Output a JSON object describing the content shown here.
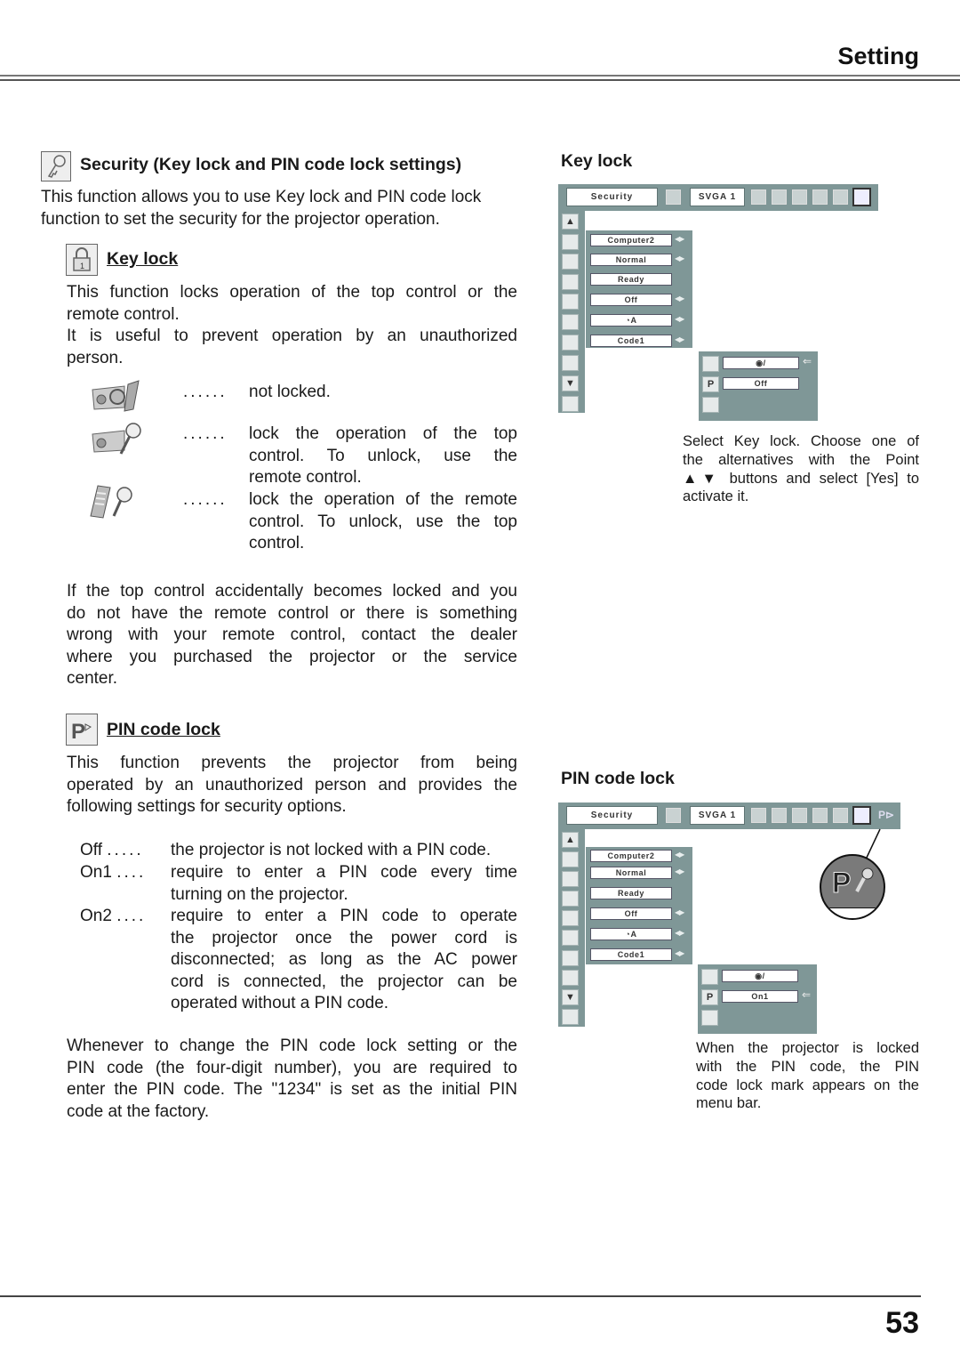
{
  "header": {
    "section_title": "Setting"
  },
  "footer": {
    "page_number": "53"
  },
  "security": {
    "icon": "key-icon",
    "title": "Security (Key lock and PIN code lock settings)",
    "intro_line1": "This function allows you to use Key lock and PIN code lock",
    "intro_line2": "function to set the security for the projector operation."
  },
  "key_lock": {
    "icon": "padlock-icon",
    "heading": "Key lock",
    "para1_line1": "This function locks operation of the top control or the",
    "para1_line2": "remote control.",
    "para2_line1": "It is useful to prevent operation by an unauthorized",
    "para2_line2": "person.",
    "options": [
      {
        "icon": "projector-unlocked-icon",
        "dots": "......",
        "lines": [
          "not locked."
        ]
      },
      {
        "icon": "projector-key-icon",
        "dots": "......",
        "lines": [
          "lock the operation of the top",
          "control.  To unlock, use the",
          "remote control."
        ]
      },
      {
        "icon": "remote-key-icon",
        "dots": "......",
        "lines": [
          "lock the operation of the remote",
          "control.  To unlock, use the top",
          "control."
        ]
      }
    ],
    "warning_lines": [
      "If the top control accidentally becomes locked and you",
      "do not have the remote control or there is something",
      "wrong with your remote control, contact the dealer",
      "where you purchased the projector or the service",
      "center."
    ]
  },
  "pin_lock": {
    "icon": "pin-code-lock-icon",
    "heading": "PIN code lock",
    "intro_lines": [
      "This function prevents the projector from being",
      "operated by an unauthorized person and provides the",
      "following settings for security options."
    ],
    "options": [
      {
        "label": "Off",
        "dots": ".....",
        "lines": [
          "the projector is not locked with a PIN code."
        ]
      },
      {
        "label": "On1",
        "dots": "....",
        "lines": [
          "require to enter a PIN code every time",
          "turning on the projector."
        ]
      },
      {
        "label": "On2",
        "dots": "....",
        "lines": [
          "require to enter a PIN code to operate",
          "the projector once the power cord is",
          "disconnected;  as long as the AC power",
          "cord is connected, the projector can be",
          "operated without a PIN code."
        ]
      }
    ],
    "note_lines": [
      "Whenever to change the PIN code lock setting or the",
      "PIN code (the four-digit number), you are required to",
      "enter the PIN code.  The \"1234\" is set as the initial PIN",
      "code at the factory."
    ]
  },
  "figure_key_lock": {
    "heading": "Key lock",
    "menu_bar": {
      "title": "Security",
      "source": "SVGA 1"
    },
    "items": [
      "Computer2",
      "Normal",
      "Ready",
      "Off",
      "lamp-auto-icon",
      "Code1"
    ],
    "sub_items": [
      {
        "icon": "padlock-icon",
        "value": "projector-unlocked-icon",
        "selected": true
      },
      {
        "icon": "pin-code-lock-icon",
        "value": "Off",
        "selected": false
      }
    ],
    "caption_lines": [
      "Select Key lock.  Choose one of",
      "the alternatives with the Point",
      "▲▼ buttons and select [Yes] to",
      "activate it."
    ]
  },
  "figure_pin_lock": {
    "heading": "PIN code lock",
    "menu_bar": {
      "title": "Security",
      "source": "SVGA 1"
    },
    "items": [
      "Computer2",
      "Normal",
      "Ready",
      "Off",
      "lamp-auto-icon",
      "Code1"
    ],
    "sub_items": [
      {
        "icon": "padlock-icon",
        "value": "projector-unlocked-icon",
        "selected": false
      },
      {
        "icon": "pin-code-lock-icon",
        "value": "On1",
        "selected": true
      }
    ],
    "badge_icon": "pin-code-lock-mark-icon",
    "caption_lines": [
      "When the projector is locked",
      "with the PIN code, the PIN",
      "code lock mark appears on the",
      "menu bar."
    ]
  },
  "colors": {
    "menu_gray": "#7f9797",
    "text": "#1a1a1a"
  }
}
